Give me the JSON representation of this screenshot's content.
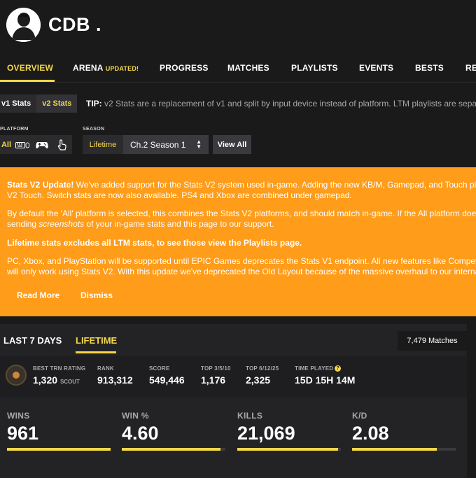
{
  "profile": {
    "name": "CDB ."
  },
  "nav": {
    "items": [
      "OVERVIEW",
      "ARENA",
      "PROGRESS",
      "MATCHES",
      "PLAYLISTS",
      "EVENTS",
      "BESTS",
      "RE"
    ],
    "arena_badge": "UPDATED!"
  },
  "version": {
    "v1": "v1 Stats",
    "v2": "v2 Stats"
  },
  "tip": {
    "label": "TIP:",
    "text": "v2 Stats are a replacement of v1 and split by input device instead of platform. LTM playlists are separa"
  },
  "filters": {
    "platform_label": "PLATFORM",
    "platform_all": "All",
    "platform_icons": [
      "keyboard-mouse-icon",
      "gamepad-icon",
      "touch-icon"
    ],
    "season_label": "SEASON",
    "season_type": "Lifetime",
    "season_value": "Ch.2 Season 1",
    "view_all": "View All"
  },
  "banner": {
    "line1_bold": "Stats V2 Update!",
    "line1": " We've added support for the Stats V2 system used in-game. Adding the new KB/M, Gamepad, and Touch platfo",
    "line2": "V2 Touch. Switch stats are now also available. PS4 and Xbox are combined under gamepad.",
    "line3": "By default the 'All' platform is selected, this combines the Stats V2 platforms, and should match in-game. If the All platform does",
    "line4_pre": "sending ",
    "line4_em": "screenshots",
    "line4_post": " of your in-game stats and this page to our support.",
    "line5": "Lifetime stats excludes all LTM stats, to see those view the Playlists page.",
    "line6": "PC, Xbox, and PlayStation will be supported until EPIC Games deprecates the Stats V1 endpoint. All new features like Competitiv",
    "line7": "will only work using Stats V2. With this update we've deprecated the Old Layout because of the massive overhaul to our internal",
    "read_more": "Read More",
    "dismiss": "Dismiss"
  },
  "stats": {
    "tabs": [
      "LAST 7 DAYS",
      "LIFETIME"
    ],
    "matches": "7,479 Matches",
    "mini": [
      {
        "label": "BEST TRN RATING",
        "value": "1,320",
        "suffix": "SCOUT"
      },
      {
        "label": "RANK",
        "value": "913,312"
      },
      {
        "label": "SCORE",
        "value": "549,446"
      },
      {
        "label": "TOP 3/5/10",
        "value": "1,176"
      },
      {
        "label": "TOP 6/12/25",
        "value": "2,325"
      },
      {
        "label": "TIME PLAYED",
        "value": "15D 15H 14M"
      }
    ],
    "big": [
      {
        "label": "WINS",
        "value": "961",
        "progress": 1.0
      },
      {
        "label": "WIN %",
        "value": "4.60",
        "progress": 0.95
      },
      {
        "label": "KILLS",
        "value": "21,069",
        "progress": 0.97
      },
      {
        "label": "K/D",
        "value": "2.08",
        "progress": 0.82
      }
    ]
  },
  "colors": {
    "accent": "#f5d849",
    "banner": "#ff9c19",
    "background": "#1a1a1b"
  }
}
